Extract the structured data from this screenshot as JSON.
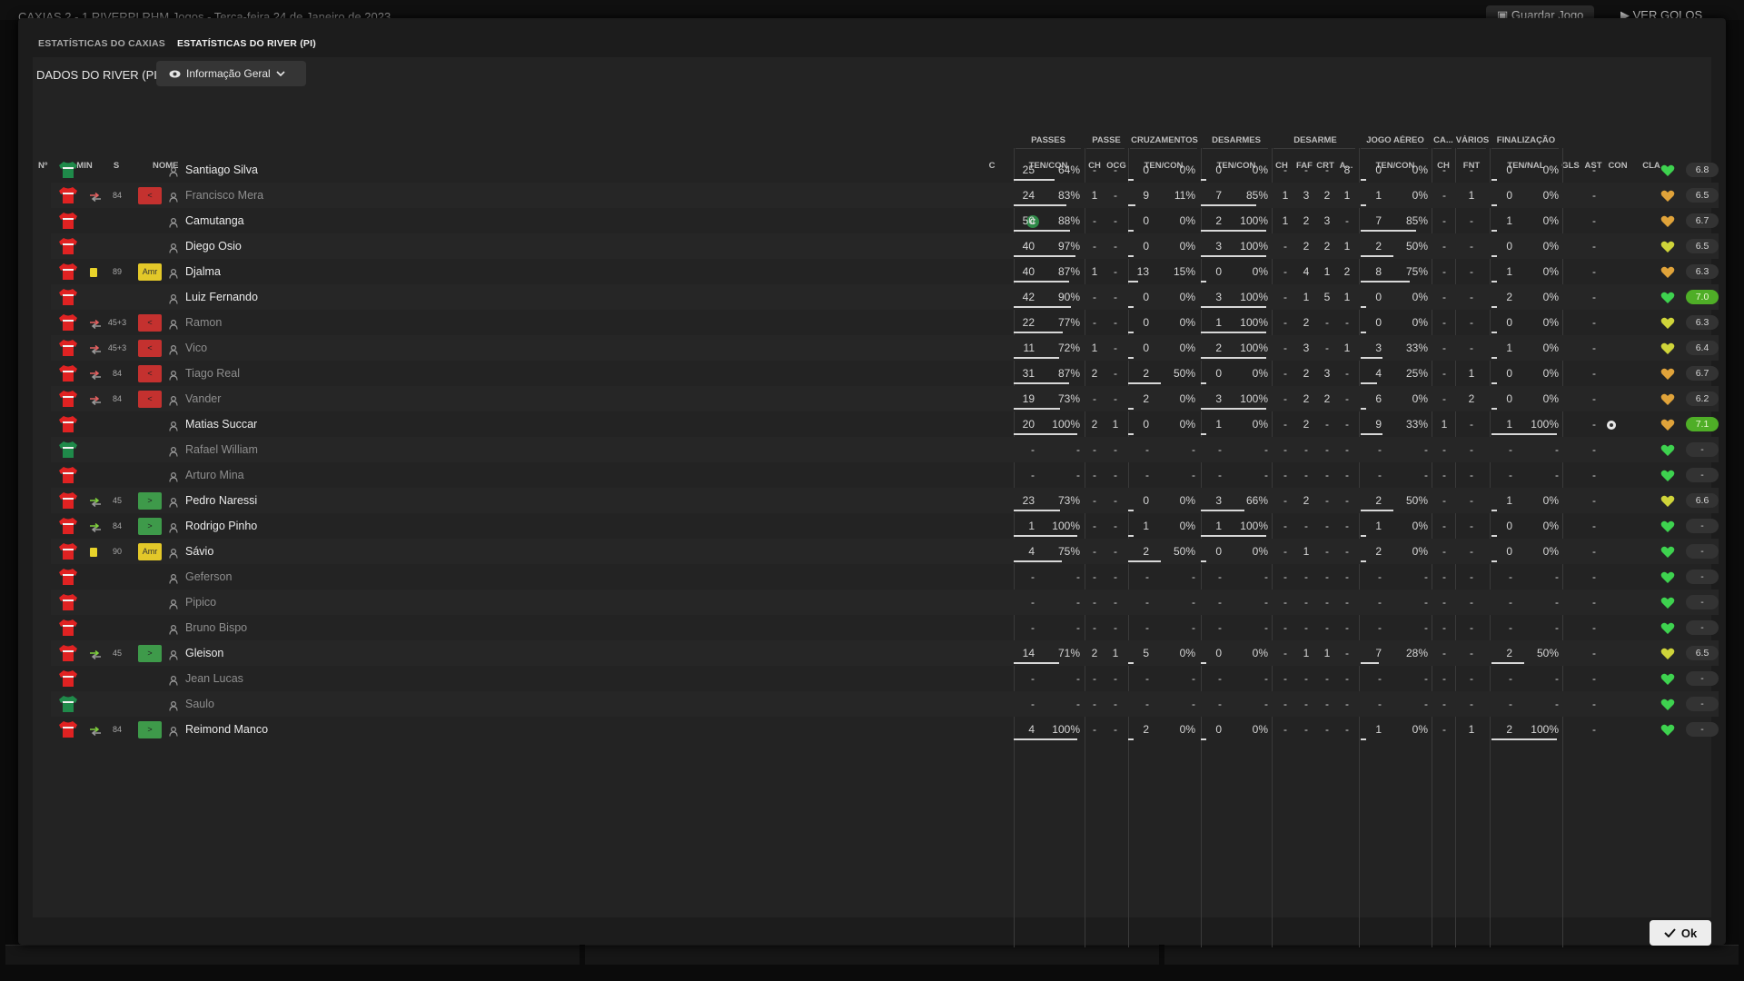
{
  "background": {
    "match_title": "CAXIAS  2 - 1  RIVERPI   RHM  Jogos   -   Terça-feira 24 de Janeiro de 2023",
    "save_button": "Guardar Jogo",
    "goals_button": "VER GOLOS"
  },
  "tabs": [
    {
      "label": "ESTATÍSTICAS DO CAXIAS",
      "active": false
    },
    {
      "label": "ESTATÍSTICAS DO RIVER (PI)",
      "active": true
    }
  ],
  "panel": {
    "title": "DADOS DO RIVER (PI)",
    "view_selector": "Informação Geral"
  },
  "groups": {
    "passes": "PASSES",
    "passe": "PASSE",
    "cruzamentos": "CRUZAMENTOS",
    "desarmes": "DESARMES",
    "desarme": "DESARME",
    "jogo_aereo": "JOGO AÉREO",
    "ca": "CA...",
    "varios": "VÁRIOS",
    "finalizacao": "FINALIZAÇÃO"
  },
  "columns": {
    "no": "Nº",
    "min": "MIN",
    "s": "S",
    "nome": "NOME",
    "c": "C",
    "passes": "TEN/CON",
    "ch1": "CH",
    "ocg": "OCG",
    "cruz": "TEN/CON",
    "des": "TEN/CON",
    "ch2": "CH",
    "faf": "FAF",
    "crt": "CRT",
    "a": "A...",
    "aer": "TEN/CON",
    "ch3": "CH",
    "fnt": "FNT",
    "fin": "TEN/NAL",
    "gls": "GLS",
    "ast": "AST",
    "con": "CON",
    "cla": "CLA"
  },
  "colors": {
    "home_shirt": "#e02222",
    "keeper_shirt": "#1f8a4a",
    "heart_green": "#3ed24f",
    "heart_yellow": "#cfd43a",
    "heart_orange": "#e0a33a",
    "rating_high": "#4fae27"
  },
  "players": [
    {
      "name": "Santiago Silva",
      "keeper": true,
      "sub_icon": "",
      "min": "",
      "badge": "",
      "pass": [
        "25",
        "64%"
      ],
      "pct": 0.64,
      "ch1": "-",
      "ocg": "-",
      "cr": [
        "0",
        "0%"
      ],
      "crp": 0,
      "de": [
        "0",
        "0%"
      ],
      "dep": 0,
      "ch2": "-",
      "faf": "-",
      "crt": "-",
      "a": "8",
      "ae": [
        "0",
        "0%"
      ],
      "aep": 0,
      "ch3": "-",
      "fnt": "-",
      "fi": [
        "0",
        "0%"
      ],
      "fip": 0,
      "gls": "",
      "ast": "-",
      "con": "green",
      "cla": "6.8",
      "hi": false,
      "dim": false
    },
    {
      "name": "Francisco Mera",
      "keeper": false,
      "sub_icon": "off",
      "min": "84",
      "badge": "<",
      "pass": [
        "24",
        "83%"
      ],
      "pct": 0.83,
      "ch1": "1",
      "ocg": "-",
      "cr": [
        "9",
        "11%"
      ],
      "crp": 0.11,
      "de": [
        "7",
        "85%"
      ],
      "dep": 0.85,
      "ch2": "1",
      "faf": "3",
      "crt": "2",
      "a": "1",
      "ae": [
        "1",
        "0%"
      ],
      "aep": 0,
      "ch3": "-",
      "fnt": "1",
      "fi": [
        "0",
        "0%"
      ],
      "fip": 0,
      "gls": "",
      "ast": "-",
      "con": "orange",
      "cla": "6.5",
      "hi": false,
      "dim": true
    },
    {
      "name": "Camutanga",
      "keeper": false,
      "sub_icon": "",
      "min": "",
      "badge": "",
      "cap": true,
      "pass": [
        "50",
        "88%"
      ],
      "pct": 0.88,
      "ch1": "-",
      "ocg": "-",
      "cr": [
        "0",
        "0%"
      ],
      "crp": 0,
      "de": [
        "2",
        "100%"
      ],
      "dep": 1,
      "ch2": "1",
      "faf": "2",
      "crt": "3",
      "a": "-",
      "ae": [
        "7",
        "85%"
      ],
      "aep": 0.85,
      "ch3": "-",
      "fnt": "-",
      "fi": [
        "1",
        "0%"
      ],
      "fip": 0,
      "gls": "",
      "ast": "-",
      "con": "orange",
      "cla": "6.7",
      "hi": false,
      "dim": false
    },
    {
      "name": "Diego Osio",
      "keeper": false,
      "sub_icon": "",
      "min": "",
      "badge": "",
      "pass": [
        "40",
        "97%"
      ],
      "pct": 0.97,
      "ch1": "-",
      "ocg": "-",
      "cr": [
        "0",
        "0%"
      ],
      "crp": 0,
      "de": [
        "3",
        "100%"
      ],
      "dep": 1,
      "ch2": "-",
      "faf": "2",
      "crt": "2",
      "a": "1",
      "ae": [
        "2",
        "50%"
      ],
      "aep": 0.5,
      "ch3": "-",
      "fnt": "-",
      "fi": [
        "0",
        "0%"
      ],
      "fip": 0,
      "gls": "",
      "ast": "-",
      "con": "yellow",
      "cla": "6.5",
      "hi": false,
      "dim": false
    },
    {
      "name": "Djalma",
      "keeper": false,
      "sub_icon": "card",
      "min": "89",
      "badge": "Amr",
      "pass": [
        "40",
        "87%"
      ],
      "pct": 0.87,
      "ch1": "1",
      "ocg": "-",
      "cr": [
        "13",
        "15%"
      ],
      "crp": 0.15,
      "de": [
        "0",
        "0%"
      ],
      "dep": 0,
      "ch2": "-",
      "faf": "4",
      "crt": "1",
      "a": "2",
      "ae": [
        "8",
        "75%"
      ],
      "aep": 0.75,
      "ch3": "-",
      "fnt": "-",
      "fi": [
        "1",
        "0%"
      ],
      "fip": 0,
      "gls": "",
      "ast": "-",
      "con": "orange",
      "cla": "6.3",
      "hi": false,
      "dim": false
    },
    {
      "name": "Luiz Fernando",
      "keeper": false,
      "sub_icon": "",
      "min": "",
      "badge": "",
      "pass": [
        "42",
        "90%"
      ],
      "pct": 0.9,
      "ch1": "-",
      "ocg": "-",
      "cr": [
        "0",
        "0%"
      ],
      "crp": 0,
      "de": [
        "3",
        "100%"
      ],
      "dep": 1,
      "ch2": "-",
      "faf": "1",
      "crt": "5",
      "a": "1",
      "ae": [
        "0",
        "0%"
      ],
      "aep": 0,
      "ch3": "-",
      "fnt": "-",
      "fi": [
        "2",
        "0%"
      ],
      "fip": 0,
      "gls": "",
      "ast": "-",
      "con": "green",
      "cla": "7.0",
      "hi": true,
      "dim": false
    },
    {
      "name": "Ramon",
      "keeper": false,
      "sub_icon": "off",
      "min": "45+3",
      "badge": "<",
      "pass": [
        "22",
        "77%"
      ],
      "pct": 0.77,
      "ch1": "-",
      "ocg": "-",
      "cr": [
        "0",
        "0%"
      ],
      "crp": 0,
      "de": [
        "1",
        "100%"
      ],
      "dep": 1,
      "ch2": "-",
      "faf": "2",
      "crt": "-",
      "a": "-",
      "ae": [
        "0",
        "0%"
      ],
      "aep": 0,
      "ch3": "-",
      "fnt": "-",
      "fi": [
        "0",
        "0%"
      ],
      "fip": 0,
      "gls": "",
      "ast": "-",
      "con": "yellow",
      "cla": "6.3",
      "hi": false,
      "dim": true
    },
    {
      "name": "Vico",
      "keeper": false,
      "sub_icon": "off",
      "min": "45+3",
      "badge": "<",
      "pass": [
        "11",
        "72%"
      ],
      "pct": 0.72,
      "ch1": "1",
      "ocg": "-",
      "cr": [
        "0",
        "0%"
      ],
      "crp": 0,
      "de": [
        "2",
        "100%"
      ],
      "dep": 1,
      "ch2": "-",
      "faf": "3",
      "crt": "-",
      "a": "1",
      "ae": [
        "3",
        "33%"
      ],
      "aep": 0.33,
      "ch3": "-",
      "fnt": "-",
      "fi": [
        "1",
        "0%"
      ],
      "fip": 0,
      "gls": "",
      "ast": "-",
      "con": "yellow",
      "cla": "6.4",
      "hi": false,
      "dim": true
    },
    {
      "name": "Tiago Real",
      "keeper": false,
      "sub_icon": "off",
      "min": "84",
      "badge": "<",
      "pass": [
        "31",
        "87%"
      ],
      "pct": 0.87,
      "ch1": "2",
      "ocg": "-",
      "cr": [
        "2",
        "50%"
      ],
      "crp": 0.5,
      "de": [
        "0",
        "0%"
      ],
      "dep": 0,
      "ch2": "-",
      "faf": "2",
      "crt": "3",
      "a": "-",
      "ae": [
        "4",
        "25%"
      ],
      "aep": 0.25,
      "ch3": "-",
      "fnt": "1",
      "fi": [
        "0",
        "0%"
      ],
      "fip": 0,
      "gls": "",
      "ast": "-",
      "con": "orange",
      "cla": "6.7",
      "hi": false,
      "dim": true
    },
    {
      "name": "Vander",
      "keeper": false,
      "sub_icon": "off",
      "min": "84",
      "badge": "<",
      "pass": [
        "19",
        "73%"
      ],
      "pct": 0.73,
      "ch1": "-",
      "ocg": "-",
      "cr": [
        "2",
        "0%"
      ],
      "crp": 0,
      "de": [
        "3",
        "100%"
      ],
      "dep": 1,
      "ch2": "-",
      "faf": "2",
      "crt": "2",
      "a": "-",
      "ae": [
        "6",
        "0%"
      ],
      "aep": 0,
      "ch3": "-",
      "fnt": "2",
      "fi": [
        "0",
        "0%"
      ],
      "fip": 0,
      "gls": "",
      "ast": "-",
      "con": "orange",
      "cla": "6.2",
      "hi": false,
      "dim": true
    },
    {
      "name": "Matias Succar",
      "keeper": false,
      "sub_icon": "",
      "min": "",
      "badge": "",
      "pass": [
        "20",
        "100%"
      ],
      "pct": 1,
      "ch1": "2",
      "ocg": "1",
      "cr": [
        "0",
        "0%"
      ],
      "crp": 0,
      "de": [
        "1",
        "0%"
      ],
      "dep": 0,
      "ch2": "-",
      "faf": "2",
      "crt": "-",
      "a": "-",
      "ae": [
        "9",
        "33%"
      ],
      "aep": 0.33,
      "ch3": "1",
      "fnt": "-",
      "fi": [
        "1",
        "100%"
      ],
      "fip": 1,
      "gls": "gear",
      "ast": "-",
      "con": "orange",
      "cla": "7.1",
      "hi": true,
      "dim": false
    },
    {
      "name": "Rafael William",
      "keeper": true,
      "sub_icon": "",
      "min": "",
      "badge": "",
      "pass": [
        "-",
        "-"
      ],
      "pct": -1,
      "ch1": "-",
      "ocg": "-",
      "cr": [
        "-",
        "-"
      ],
      "crp": -1,
      "de": [
        "-",
        "-"
      ],
      "dep": -1,
      "ch2": "-",
      "faf": "-",
      "crt": "-",
      "a": "-",
      "ae": [
        "-",
        "-"
      ],
      "aep": -1,
      "ch3": "-",
      "fnt": "-",
      "fi": [
        "-",
        "-"
      ],
      "fip": -1,
      "gls": "",
      "ast": "-",
      "con": "green",
      "cla": "-",
      "hi": false,
      "dim": true
    },
    {
      "name": "Arturo Mina",
      "keeper": false,
      "sub_icon": "",
      "min": "",
      "badge": "",
      "pass": [
        "-",
        "-"
      ],
      "pct": -1,
      "ch1": "-",
      "ocg": "-",
      "cr": [
        "-",
        "-"
      ],
      "crp": -1,
      "de": [
        "-",
        "-"
      ],
      "dep": -1,
      "ch2": "-",
      "faf": "-",
      "crt": "-",
      "a": "-",
      "ae": [
        "-",
        "-"
      ],
      "aep": -1,
      "ch3": "-",
      "fnt": "-",
      "fi": [
        "-",
        "-"
      ],
      "fip": -1,
      "gls": "",
      "ast": "-",
      "con": "green",
      "cla": "-",
      "hi": false,
      "dim": true
    },
    {
      "name": "Pedro Naressi",
      "keeper": false,
      "sub_icon": "on",
      "min": "45",
      "badge": ">",
      "pass": [
        "23",
        "73%"
      ],
      "pct": 0.73,
      "ch1": "-",
      "ocg": "-",
      "cr": [
        "0",
        "0%"
      ],
      "crp": 0,
      "de": [
        "3",
        "66%"
      ],
      "dep": 0.66,
      "ch2": "-",
      "faf": "2",
      "crt": "-",
      "a": "-",
      "ae": [
        "2",
        "50%"
      ],
      "aep": 0.5,
      "ch3": "-",
      "fnt": "-",
      "fi": [
        "1",
        "0%"
      ],
      "fip": 0,
      "gls": "",
      "ast": "-",
      "con": "yellow",
      "cla": "6.6",
      "hi": false,
      "dim": false
    },
    {
      "name": "Rodrigo Pinho",
      "keeper": false,
      "sub_icon": "on",
      "min": "84",
      "badge": ">",
      "pass": [
        "1",
        "100%"
      ],
      "pct": 1,
      "ch1": "-",
      "ocg": "-",
      "cr": [
        "1",
        "0%"
      ],
      "crp": 0,
      "de": [
        "1",
        "100%"
      ],
      "dep": 1,
      "ch2": "-",
      "faf": "-",
      "crt": "-",
      "a": "-",
      "ae": [
        "1",
        "0%"
      ],
      "aep": 0,
      "ch3": "-",
      "fnt": "-",
      "fi": [
        "0",
        "0%"
      ],
      "fip": 0,
      "gls": "",
      "ast": "-",
      "con": "green",
      "cla": "-",
      "hi": false,
      "dim": false
    },
    {
      "name": "Sávio",
      "keeper": false,
      "sub_icon": "card",
      "min": "90",
      "badge": "Amr",
      "pass": [
        "4",
        "75%"
      ],
      "pct": 0.75,
      "ch1": "-",
      "ocg": "-",
      "cr": [
        "2",
        "50%"
      ],
      "crp": 0.5,
      "de": [
        "0",
        "0%"
      ],
      "dep": 0,
      "ch2": "-",
      "faf": "1",
      "crt": "-",
      "a": "-",
      "ae": [
        "2",
        "0%"
      ],
      "aep": 0,
      "ch3": "-",
      "fnt": "-",
      "fi": [
        "0",
        "0%"
      ],
      "fip": 0,
      "gls": "",
      "ast": "-",
      "con": "green",
      "cla": "-",
      "hi": false,
      "dim": false
    },
    {
      "name": "Geferson",
      "keeper": false,
      "sub_icon": "",
      "min": "",
      "badge": "",
      "pass": [
        "-",
        "-"
      ],
      "pct": -1,
      "ch1": "-",
      "ocg": "-",
      "cr": [
        "-",
        "-"
      ],
      "crp": -1,
      "de": [
        "-",
        "-"
      ],
      "dep": -1,
      "ch2": "-",
      "faf": "-",
      "crt": "-",
      "a": "-",
      "ae": [
        "-",
        "-"
      ],
      "aep": -1,
      "ch3": "-",
      "fnt": "-",
      "fi": [
        "-",
        "-"
      ],
      "fip": -1,
      "gls": "",
      "ast": "-",
      "con": "green",
      "cla": "-",
      "hi": false,
      "dim": true
    },
    {
      "name": "Pipico",
      "keeper": false,
      "sub_icon": "",
      "min": "",
      "badge": "",
      "pass": [
        "-",
        "-"
      ],
      "pct": -1,
      "ch1": "-",
      "ocg": "-",
      "cr": [
        "-",
        "-"
      ],
      "crp": -1,
      "de": [
        "-",
        "-"
      ],
      "dep": -1,
      "ch2": "-",
      "faf": "-",
      "crt": "-",
      "a": "-",
      "ae": [
        "-",
        "-"
      ],
      "aep": -1,
      "ch3": "-",
      "fnt": "-",
      "fi": [
        "-",
        "-"
      ],
      "fip": -1,
      "gls": "",
      "ast": "-",
      "con": "green",
      "cla": "-",
      "hi": false,
      "dim": true
    },
    {
      "name": "Bruno Bispo",
      "keeper": false,
      "sub_icon": "",
      "min": "",
      "badge": "",
      "pass": [
        "-",
        "-"
      ],
      "pct": -1,
      "ch1": "-",
      "ocg": "-",
      "cr": [
        "-",
        "-"
      ],
      "crp": -1,
      "de": [
        "-",
        "-"
      ],
      "dep": -1,
      "ch2": "-",
      "faf": "-",
      "crt": "-",
      "a": "-",
      "ae": [
        "-",
        "-"
      ],
      "aep": -1,
      "ch3": "-",
      "fnt": "-",
      "fi": [
        "-",
        "-"
      ],
      "fip": -1,
      "gls": "",
      "ast": "-",
      "con": "green",
      "cla": "-",
      "hi": false,
      "dim": true
    },
    {
      "name": "Gleison",
      "keeper": false,
      "sub_icon": "on",
      "min": "45",
      "badge": ">",
      "pass": [
        "14",
        "71%"
      ],
      "pct": 0.71,
      "ch1": "2",
      "ocg": "1",
      "cr": [
        "5",
        "0%"
      ],
      "crp": 0,
      "de": [
        "0",
        "0%"
      ],
      "dep": 0,
      "ch2": "-",
      "faf": "1",
      "crt": "1",
      "a": "-",
      "ae": [
        "7",
        "28%"
      ],
      "aep": 0.28,
      "ch3": "-",
      "fnt": "-",
      "fi": [
        "2",
        "50%"
      ],
      "fip": 0.5,
      "gls": "",
      "ast": "-",
      "con": "yellow",
      "cla": "6.5",
      "hi": false,
      "dim": false
    },
    {
      "name": "Jean Lucas",
      "keeper": false,
      "sub_icon": "",
      "min": "",
      "badge": "",
      "pass": [
        "-",
        "-"
      ],
      "pct": -1,
      "ch1": "-",
      "ocg": "-",
      "cr": [
        "-",
        "-"
      ],
      "crp": -1,
      "de": [
        "-",
        "-"
      ],
      "dep": -1,
      "ch2": "-",
      "faf": "-",
      "crt": "-",
      "a": "-",
      "ae": [
        "-",
        "-"
      ],
      "aep": -1,
      "ch3": "-",
      "fnt": "-",
      "fi": [
        "-",
        "-"
      ],
      "fip": -1,
      "gls": "",
      "ast": "-",
      "con": "green",
      "cla": "-",
      "hi": false,
      "dim": true
    },
    {
      "name": "Saulo",
      "keeper": true,
      "sub_icon": "",
      "min": "",
      "badge": "",
      "pass": [
        "-",
        "-"
      ],
      "pct": -1,
      "ch1": "-",
      "ocg": "-",
      "cr": [
        "-",
        "-"
      ],
      "crp": -1,
      "de": [
        "-",
        "-"
      ],
      "dep": -1,
      "ch2": "-",
      "faf": "-",
      "crt": "-",
      "a": "-",
      "ae": [
        "-",
        "-"
      ],
      "aep": -1,
      "ch3": "-",
      "fnt": "-",
      "fi": [
        "-",
        "-"
      ],
      "fip": -1,
      "gls": "",
      "ast": "-",
      "con": "green",
      "cla": "-",
      "hi": false,
      "dim": true
    },
    {
      "name": "Reimond Manco",
      "keeper": false,
      "sub_icon": "on",
      "min": "84",
      "badge": ">",
      "pass": [
        "4",
        "100%"
      ],
      "pct": 1,
      "ch1": "-",
      "ocg": "-",
      "cr": [
        "2",
        "0%"
      ],
      "crp": 0,
      "de": [
        "0",
        "0%"
      ],
      "dep": 0,
      "ch2": "-",
      "faf": "-",
      "crt": "-",
      "a": "-",
      "ae": [
        "1",
        "0%"
      ],
      "aep": 0,
      "ch3": "-",
      "fnt": "1",
      "fi": [
        "2",
        "100%"
      ],
      "fip": 1,
      "gls": "",
      "ast": "-",
      "con": "green",
      "cla": "-",
      "hi": false,
      "dim": false
    }
  ],
  "ok_button": "Ok"
}
